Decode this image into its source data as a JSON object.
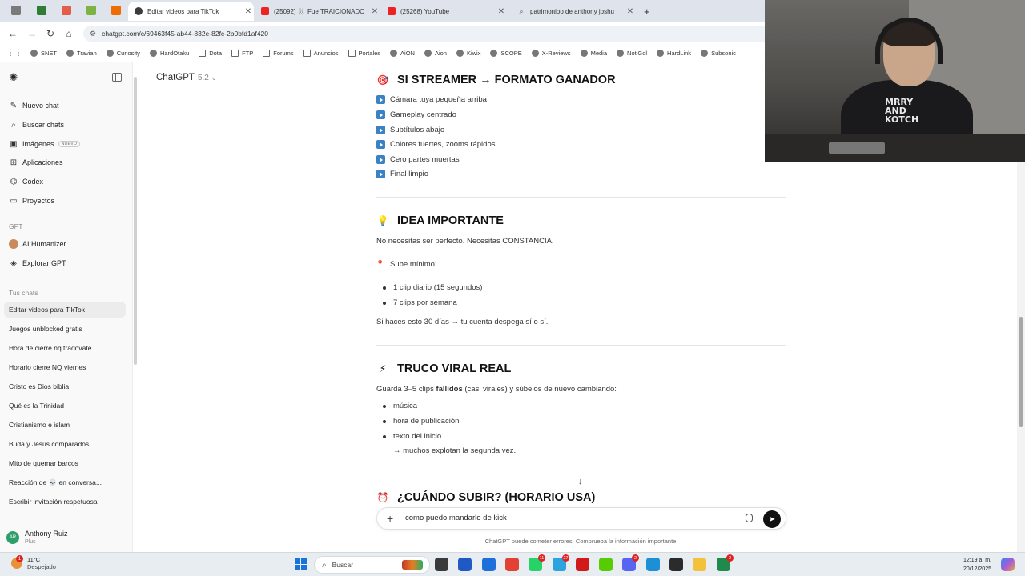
{
  "browser": {
    "tabs": [
      {
        "label": "Editar videos para TikTok",
        "color": "#3c3c3c"
      },
      {
        "label": "(25092) 🐰 Fue TRAICIONADO",
        "color": "#e22"
      },
      {
        "label": "(25268) YouTube",
        "color": "#e22"
      },
      {
        "label": "patrimonioo de anthony joshu",
        "color": "#777"
      }
    ],
    "new_tab_icon": "plus-icon",
    "url": "chatgpt.com/c/69463f45-ab44-832e-82fc-2b0bfd1af420",
    "bookmarks": [
      "SNET",
      "Travian",
      "Curiosity",
      "HardOtaku",
      "Dota",
      "FTP",
      "Forums",
      "Anuncios",
      "Portales",
      "AiON",
      "Aion",
      "Kiwix",
      "SCOPE",
      "X-Reviews",
      "Media",
      "NotiGol",
      "HardLink",
      "Subsonic"
    ]
  },
  "sidebar": {
    "nav": [
      {
        "label": "Nuevo chat",
        "icon": "edit-icon"
      },
      {
        "label": "Buscar chats",
        "icon": "search-icon"
      },
      {
        "label": "Imágenes",
        "icon": "image-icon",
        "badge": "NUEVO"
      },
      {
        "label": "Aplicaciones",
        "icon": "apps-icon"
      },
      {
        "label": "Codex",
        "icon": "code-icon"
      },
      {
        "label": "Proyectos",
        "icon": "folder-icon"
      }
    ],
    "gpt_section": "GPT",
    "gpts": [
      {
        "label": "AI Humanizer"
      },
      {
        "label": "Explorar GPT"
      }
    ],
    "chats_section": "Tus chats",
    "chats": [
      "Editar videos para TikTok",
      "Juegos unblocked gratis",
      "Hora de cierre nq tradovate",
      "Horario cierre NQ viernes",
      "Cristo es Dios biblia",
      "Qué es la Trinidad",
      "Cristianismo e islam",
      "Buda y Jesús comparados",
      "Mito de quemar barcos",
      "Reacción de 💀 en conversa...",
      "Escribir invitación respetuosa"
    ],
    "user": {
      "initials": "AR",
      "name": "Anthony Ruiz",
      "plan": "Plus"
    }
  },
  "main": {
    "model": {
      "name": "ChatGPT",
      "version": "5.2"
    },
    "section1": {
      "emoji": "🎯",
      "title": "SI STREAMER → FORMATO GANADOR",
      "items": [
        "Cámara tuya pequeña arriba",
        "Gameplay centrado",
        "Subtítulos abajo",
        "Colores fuertes, zooms rápidos",
        "Cero partes muertas",
        "Final limpio"
      ]
    },
    "section2": {
      "emoji": "💡",
      "title": "IDEA IMPORTANTE",
      "intro": "No necesitas ser perfecto. Necesitas CONSTANCIA.",
      "pin_label": "Sube mínimo:",
      "bullets": [
        "1 clip diario (15 segundos)",
        "7 clips por semana"
      ],
      "outro": "Si haces esto 30 días → tu cuenta despega sí o sí."
    },
    "section3": {
      "emoji": "⚡",
      "title": "TRUCO VIRAL REAL",
      "intro_pre": "Guarda 3–5 clips ",
      "intro_bold": "fallidos",
      "intro_post": " (casi virales) y súbelos de nuevo cambiando:",
      "bullets": [
        "música",
        "hora de publicación",
        "texto del inicio"
      ],
      "note": "→ muchos explotan la segunda vez."
    },
    "section4": {
      "emoji": "⏰",
      "title": "¿CUÁNDO SUBIR? (HORARIO USA)"
    },
    "composer": {
      "value": "como puedo mandarlo de kick",
      "send_icon": "send-icon",
      "mic_icon": "mic-icon"
    },
    "disclaimer": "ChatGPT puede cometer errores. Comprueba la información importante."
  },
  "webcam": {
    "shirt_text": "MRRY AND KOTCH"
  },
  "taskbar": {
    "weather": {
      "temp": "11°C",
      "desc": "Despejado",
      "notif": "1"
    },
    "search_label": "Buscar",
    "apps": [
      {
        "name": "task-view",
        "color": "#3a3a3a"
      },
      {
        "name": "calendar",
        "color": "#2159c4"
      },
      {
        "name": "store",
        "color": "#1e6fd9"
      },
      {
        "name": "chrome",
        "color": "#e34133"
      },
      {
        "name": "whatsapp",
        "color": "#25d366",
        "badge": "11"
      },
      {
        "name": "telegram",
        "color": "#2aa3df",
        "badge": "27"
      },
      {
        "name": "netflix",
        "color": "#d11b1b"
      },
      {
        "name": "duolingo",
        "color": "#58cc02"
      },
      {
        "name": "discord",
        "color": "#5865f2",
        "badge": "2"
      },
      {
        "name": "edge",
        "color": "#1c8fd6"
      },
      {
        "name": "obs",
        "color": "#2b2b2b"
      },
      {
        "name": "explorer",
        "color": "#f3c13a"
      },
      {
        "name": "excel",
        "color": "#1f8a4c",
        "badge": "2"
      }
    ],
    "time": "12:19 a. m.",
    "date": "20/12/2025"
  }
}
